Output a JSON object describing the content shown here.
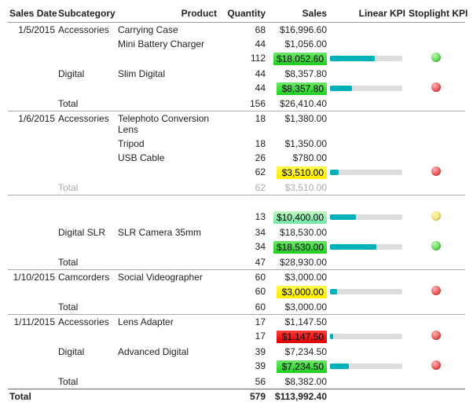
{
  "columns": {
    "sales_date": "Sales Date",
    "subcategory": "Subcategory",
    "product": "Product",
    "quantity": "Quantity",
    "sales": "Sales",
    "linear_kpi": "Linear KPI",
    "stoplight_kpi": "Stoplight KPI"
  },
  "rows": [
    {
      "type": "detail",
      "top": true,
      "date": "1/5/2015",
      "subcategory": "Accessories",
      "product": "Carrying Case",
      "qty": "68",
      "sales": "$16,996.60"
    },
    {
      "type": "detail",
      "product": "Mini Battery Charger",
      "qty": "44",
      "sales": "$1,056.00"
    },
    {
      "type": "subtotal",
      "qty": "112",
      "sales": "$18,052.60",
      "hi": "green",
      "linear": 62,
      "stoplight": "g"
    },
    {
      "type": "detail",
      "subcategory": "Digital",
      "product": "Slim Digital",
      "qty": "44",
      "sales": "$8,357.80"
    },
    {
      "type": "subtotal",
      "qty": "44",
      "sales": "$8,357.80",
      "hi": "green",
      "linear": 30,
      "stoplight": "r"
    },
    {
      "type": "total",
      "label": "Total",
      "qty": "156",
      "sales": "$26,410.40"
    },
    {
      "type": "detail",
      "top": true,
      "date": "1/6/2015",
      "subcategory": "Accessories",
      "product": "Telephoto Conversion Lens",
      "qty": "18",
      "sales": "$1,380.00"
    },
    {
      "type": "detail",
      "product": "Tripod",
      "qty": "18",
      "sales": "$1,350.00"
    },
    {
      "type": "detail",
      "product": "USB Cable",
      "qty": "26",
      "sales": "$780.00"
    },
    {
      "type": "subtotal",
      "qty": "62",
      "sales": "$3,510.00",
      "hi": "yellow",
      "linear": 12,
      "stoplight": "r"
    },
    {
      "type": "total",
      "label": "Total",
      "qty": "62",
      "sales": "$3,510.00",
      "faded": true
    },
    {
      "type": "spacer"
    },
    {
      "type": "subtotal",
      "qty": "13",
      "sales": "$10,400.00",
      "hi": "mint",
      "linear": 36,
      "stoplight": "y"
    },
    {
      "type": "detail",
      "subcategory": "Digital SLR",
      "product": "SLR Camera 35mm",
      "qty": "34",
      "sales": "$18,530.00"
    },
    {
      "type": "subtotal",
      "qty": "34",
      "sales": "$18,530.00",
      "hi": "green",
      "linear": 64,
      "stoplight": "g"
    },
    {
      "type": "total",
      "label": "Total",
      "qty": "47",
      "sales": "$28,930.00"
    },
    {
      "type": "detail",
      "top": true,
      "date": "1/10/2015",
      "subcategory": "Camcorders",
      "product": "Social Videographer",
      "qty": "60",
      "sales": "$3,000.00"
    },
    {
      "type": "subtotal",
      "qty": "60",
      "sales": "$3,000.00",
      "hi": "yellow",
      "linear": 10,
      "stoplight": "r"
    },
    {
      "type": "total",
      "label": "Total",
      "qty": "60",
      "sales": "$3,000.00"
    },
    {
      "type": "detail",
      "top": true,
      "date": "1/11/2015",
      "subcategory": "Accessories",
      "product": "Lens Adapter",
      "qty": "17",
      "sales": "$1,147.50"
    },
    {
      "type": "subtotal",
      "qty": "17",
      "sales": "$1,147.50",
      "hi": "red",
      "linear": 4,
      "stoplight": "r"
    },
    {
      "type": "detail",
      "subcategory": "Digital",
      "product": "Advanced Digital",
      "qty": "39",
      "sales": "$7,234.50"
    },
    {
      "type": "subtotal",
      "qty": "39",
      "sales": "$7,234.50",
      "hi": "green",
      "linear": 26,
      "stoplight": "r"
    },
    {
      "type": "total",
      "label": "Total",
      "qty": "56",
      "sales": "$8,382.00"
    }
  ],
  "grand_total": {
    "label": "Total",
    "qty": "579",
    "sales": "$113,992.40"
  },
  "chart_data": {
    "type": "table",
    "title": "Sales matrix with Linear and Stoplight KPI indicators",
    "columns": [
      "Sales Date",
      "Subcategory",
      "Product",
      "Quantity",
      "Sales",
      "Linear KPI",
      "Stoplight KPI"
    ],
    "kpi": {
      "green": 1,
      "yellow": 0,
      "red": -1,
      "linear_range": [
        0,
        1
      ]
    },
    "groups": [
      {
        "date": "1/5/2015",
        "subcategory": "Accessories",
        "items": [
          {
            "product": "Carrying Case",
            "qty": 68,
            "sales": 16996.6
          },
          {
            "product": "Mini Battery Charger",
            "qty": 44,
            "sales": 1056.0
          }
        ],
        "subtotal": {
          "qty": 112,
          "sales": 18052.6,
          "linear": 0.62,
          "stoplight": "green"
        }
      },
      {
        "date": "1/5/2015",
        "subcategory": "Digital",
        "items": [
          {
            "product": "Slim Digital",
            "qty": 44,
            "sales": 8357.8
          }
        ],
        "subtotal": {
          "qty": 44,
          "sales": 8357.8,
          "linear": 0.3,
          "stoplight": "red"
        },
        "date_total": {
          "qty": 156,
          "sales": 26410.4
        }
      },
      {
        "date": "1/6/2015",
        "subcategory": "Accessories",
        "items": [
          {
            "product": "Telephoto Conversion Lens",
            "qty": 18,
            "sales": 1380.0
          },
          {
            "product": "Tripod",
            "qty": 18,
            "sales": 1350.0
          },
          {
            "product": "USB Cable",
            "qty": 26,
            "sales": 780.0
          }
        ],
        "subtotal": {
          "qty": 62,
          "sales": 3510.0,
          "linear": 0.12,
          "stoplight": "red"
        },
        "date_total": {
          "qty": 62,
          "sales": 3510.0
        }
      },
      {
        "date": "1/6/2015",
        "subcategory": "",
        "items": [],
        "subtotal": {
          "qty": 13,
          "sales": 10400.0,
          "linear": 0.36,
          "stoplight": "yellow"
        }
      },
      {
        "date": "1/6/2015",
        "subcategory": "Digital SLR",
        "items": [
          {
            "product": "SLR Camera 35mm",
            "qty": 34,
            "sales": 18530.0
          }
        ],
        "subtotal": {
          "qty": 34,
          "sales": 18530.0,
          "linear": 0.64,
          "stoplight": "green"
        },
        "date_total": {
          "qty": 47,
          "sales": 28930.0
        }
      },
      {
        "date": "1/10/2015",
        "subcategory": "Camcorders",
        "items": [
          {
            "product": "Social Videographer",
            "qty": 60,
            "sales": 3000.0
          }
        ],
        "subtotal": {
          "qty": 60,
          "sales": 3000.0,
          "linear": 0.1,
          "stoplight": "red"
        },
        "date_total": {
          "qty": 60,
          "sales": 3000.0
        }
      },
      {
        "date": "1/11/2015",
        "subcategory": "Accessories",
        "items": [
          {
            "product": "Lens Adapter",
            "qty": 17,
            "sales": 1147.5
          }
        ],
        "subtotal": {
          "qty": 17,
          "sales": 1147.5,
          "linear": 0.04,
          "stoplight": "red"
        }
      },
      {
        "date": "1/11/2015",
        "subcategory": "Digital",
        "items": [
          {
            "product": "Advanced Digital",
            "qty": 39,
            "sales": 7234.5
          }
        ],
        "subtotal": {
          "qty": 39,
          "sales": 7234.5,
          "linear": 0.26,
          "stoplight": "red"
        },
        "date_total": {
          "qty": 56,
          "sales": 8382.0
        }
      }
    ],
    "grand_total": {
      "qty": 579,
      "sales": 113992.4
    }
  }
}
